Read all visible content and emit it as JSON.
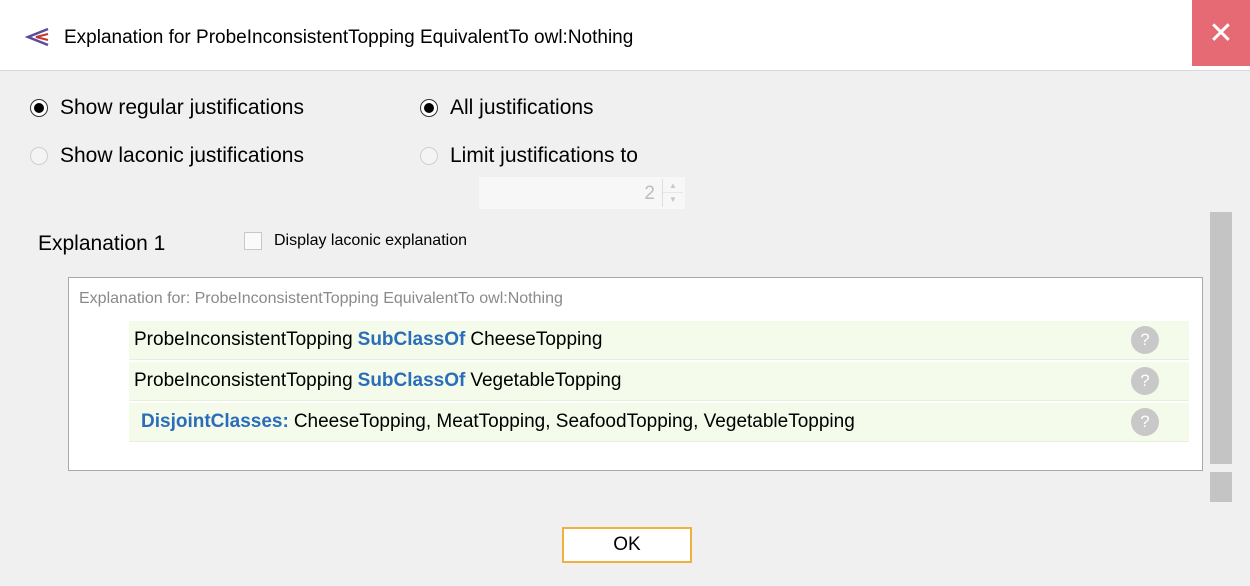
{
  "window": {
    "title": "Explanation for ProbeInconsistentTopping EquivalentTo owl:Nothing",
    "close_symbol": "✕"
  },
  "options": {
    "show_regular": "Show regular justifications",
    "show_laconic": "Show laconic justifications",
    "all_justifications": "All justifications",
    "limit_justifications": "Limit justifications to",
    "limit_value": "2"
  },
  "explanation": {
    "heading": "Explanation 1",
    "laconic_checkbox_label": "Display laconic explanation",
    "header": "Explanation for: ProbeInconsistentTopping EquivalentTo owl:Nothing",
    "axioms": [
      {
        "subject": "ProbeInconsistentTopping",
        "keyword": "SubClassOf",
        "object": "CheeseTopping"
      },
      {
        "subject": "ProbeInconsistentTopping",
        "keyword": "SubClassOf",
        "object": "VegetableTopping"
      },
      {
        "keyword": "DisjointClasses:",
        "object": "CheeseTopping, MeatTopping, SeafoodTopping, VegetableTopping"
      }
    ],
    "help_symbol": "?"
  },
  "buttons": {
    "ok": "OK"
  },
  "colors": {
    "keyword": "#2a6db8",
    "close_bg": "#e66a73",
    "row_bg": "#f4fbea",
    "ok_border": "#f0b040"
  }
}
